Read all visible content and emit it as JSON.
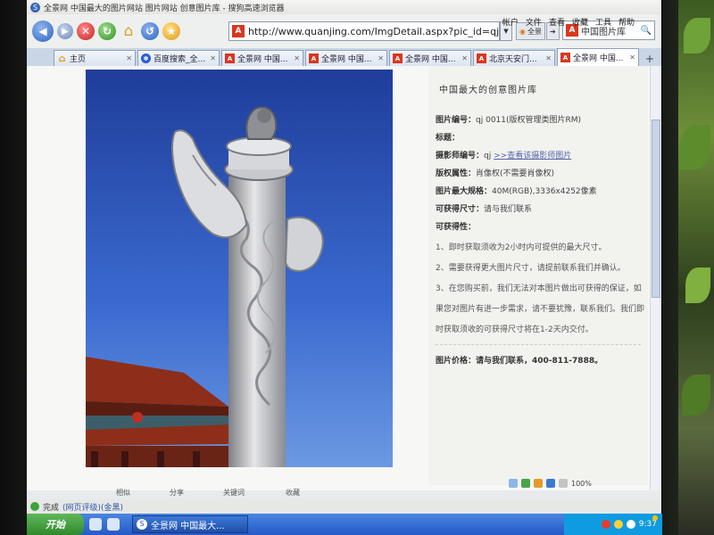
{
  "window": {
    "title": "全景网 中国最大的图片网站 图片网站 创意图片库 - 搜狗高速浏览器"
  },
  "menu": [
    "帐户",
    "文件",
    "查看",
    "收藏",
    "工具",
    "帮助"
  ],
  "toolbar": {
    "url": "http://www.quanjing.com/ImgDetail.aspx?pic_id=qj-0",
    "site_icon_letter": "A",
    "mini_button_label": "全景",
    "search_value": "中国图片库"
  },
  "tabs": [
    {
      "label": "主页",
      "icon": "home-icon",
      "active": false
    },
    {
      "label": "百度搜索_全...",
      "icon": "paw-icon",
      "active": false
    },
    {
      "label": "全景网 中国...",
      "icon": "site-icon",
      "active": false
    },
    {
      "label": "全景网 中国...",
      "icon": "site-icon",
      "active": false
    },
    {
      "label": "全景网 中国...",
      "icon": "site-icon",
      "active": false
    },
    {
      "label": "北京天安门...",
      "icon": "site-icon",
      "active": false
    },
    {
      "label": "全景网 中国...",
      "icon": "site-icon",
      "active": true
    }
  ],
  "page": {
    "heading": "中国最大的创意图片库",
    "fields": [
      {
        "label": "图片编号：",
        "value": "qj 0011(版权管理类图片RM)"
      },
      {
        "label": "标题：",
        "value": ""
      },
      {
        "label": "摄影师编号：",
        "value": "qj",
        "link": ">>查看该摄影师图片"
      },
      {
        "label": "版权属性：",
        "value": "肖像权(不需要肖像权)"
      },
      {
        "label": "图片最大规格：",
        "value": "40M(RGB),3336x4252像素"
      },
      {
        "label": "可获得尺寸：",
        "value": "请与我们联系"
      },
      {
        "label": "可获得性：",
        "value": ""
      }
    ],
    "notes": [
      "1、即时获取须收为2小时内可提供的最大尺寸。",
      "2、需要获得更大图片尺寸，请提前联系我们并确认。",
      "3、在您购买前，我们无法对本图片做出可获得的保证，如",
      "果您对图片有进一步需求，请不要犹豫，联系我们。我们即",
      "时获取须收的可获得尺寸将在1-2天内交付。"
    ],
    "price": "图片价格：请与我们联系，400-811-7888。"
  },
  "bottom_tabs": [
    "相似",
    "分享",
    "关键词",
    "收藏"
  ],
  "status": {
    "text": "完成",
    "link": "(网页评级)(金黑)",
    "zoom": "100%",
    "clock": "9:37"
  },
  "taskbar": {
    "start_label": "开始",
    "task_item": "全景网 中国最大..."
  }
}
